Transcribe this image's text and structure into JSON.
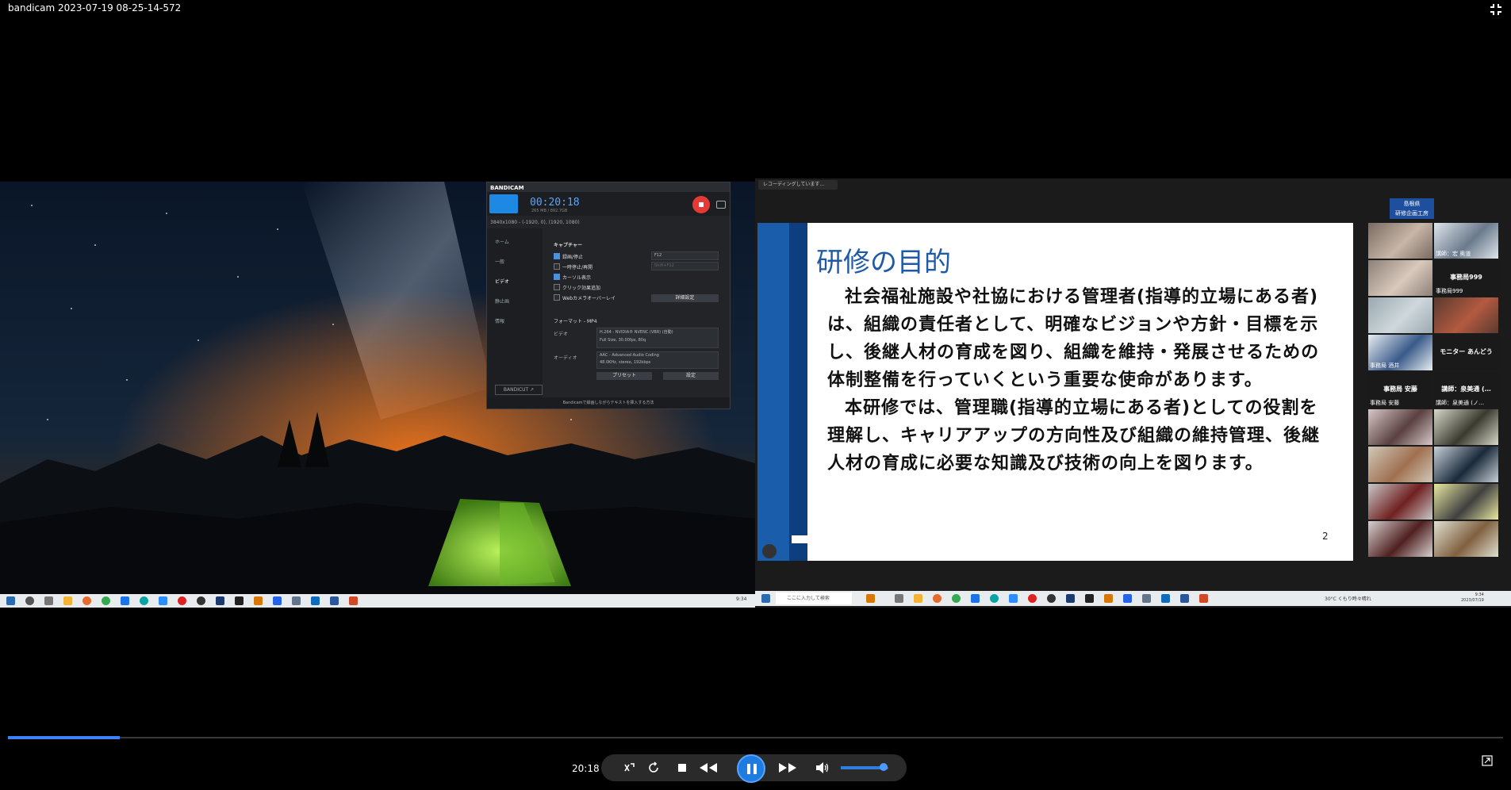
{
  "window": {
    "title": "bandicam 2023-07-19 08-25-14-572"
  },
  "bandicam": {
    "logo": "BANDICAM",
    "timer": "00:20:18",
    "size": "265 MB / 892.7GB",
    "resolution": "3840x1080 - (-1920, 0), (1920, 1080)",
    "sidebar": [
      "ホーム",
      "一般",
      "ビデオ",
      "静止画",
      "情報"
    ],
    "section_capture": "キャプチャー",
    "options": [
      {
        "label": "録画/停止",
        "checked": true
      },
      {
        "label": "一時停止/再開",
        "checked": false
      },
      {
        "label": "カーソル表示",
        "checked": true
      },
      {
        "label": "クリック効果追加",
        "checked": false
      },
      {
        "label": "Webカメラオーバーレイ",
        "checked": false
      }
    ],
    "hotkey": "F12",
    "hotkey2": "Shift+F12",
    "advanced_button": "詳細設定",
    "format_label": "フォーマット - MP4",
    "video_label": "ビデオ",
    "video_value1": "H.264 - NVIDIA® NVENC (VBR) (自動)",
    "video_value2": "Full Size, 30.00fps, 80q",
    "audio_label": "オーディオ",
    "audio_value1": "AAC - Advanced Audio Coding",
    "audio_value2": "48.0KHz, stereo, 192kbps",
    "preset_button": "プリセット",
    "settings_button": "設定",
    "bandicut": "BANDICUT ↗",
    "footer": "Bandicamで録画しながらテキストを挿入する方法"
  },
  "left_taskbar": {
    "clock": "9:34"
  },
  "zoom": {
    "recording_indicator": "レコーディングしています...",
    "org_badge": [
      "島根県",
      "研修企画工房"
    ],
    "participants": [
      {
        "name": "",
        "center": ""
      },
      {
        "name": "講師：宏 奥道",
        "center": ""
      },
      {
        "name": "",
        "center": ""
      },
      {
        "name": "事務局999",
        "center": "事務局999"
      },
      {
        "name": "",
        "center": ""
      },
      {
        "name": "",
        "center": ""
      },
      {
        "name": "事務局 酒井",
        "center": ""
      },
      {
        "name": "",
        "center": "モニター あんどう"
      },
      {
        "name": "事務局 安藤",
        "center": "事務局 安藤"
      },
      {
        "name": "講師：泉美通 (ノ…",
        "center": "講師：泉美通 (…"
      },
      {
        "name": "",
        "center": ""
      },
      {
        "name": "",
        "center": ""
      },
      {
        "name": "",
        "center": ""
      },
      {
        "name": "",
        "center": ""
      },
      {
        "name": "",
        "center": ""
      },
      {
        "name": "",
        "center": ""
      },
      {
        "name": "",
        "center": ""
      },
      {
        "name": "",
        "center": ""
      }
    ]
  },
  "slide": {
    "title": "研修の目的",
    "paragraph1": "社会福祉施設や社協における管理者(指導的立場にある者)は、組織の責任者として、明確なビジョンや方針・目標を示し、後継人材の育成を図り、組織を維持・発展させるための体制整備を行っていくという重要な使命があります。",
    "paragraph2": "本研修では、管理職(指導的立場にある者)としての役割を理解し、キャリアアップの方向性及び組織の維持管理、後継人材の育成に必要な知識及び技術の向上を図ります。",
    "page": "2"
  },
  "right_taskbar": {
    "search_placeholder": "ここに入力して検索",
    "weather": "30°C くもり時々晴れ",
    "clock_time": "9:34",
    "clock_date": "2023/07/19"
  },
  "player": {
    "elapsed": "20:18",
    "progress": 0.075,
    "volume": 0.9,
    "accent": "#1e7be0"
  }
}
